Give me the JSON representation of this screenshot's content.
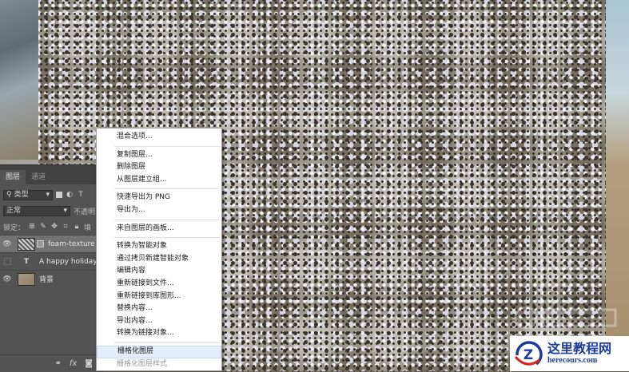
{
  "panel": {
    "tabs": [
      {
        "label": "图层",
        "active": true
      },
      {
        "label": "通道",
        "active": false
      }
    ],
    "filter": {
      "kind": "类型"
    },
    "blend_mode": "正常",
    "opacity_label": "不透明",
    "lock_label": "锁定：",
    "fill_label": "填",
    "layers": [
      {
        "name": "foam-texture",
        "visible": true,
        "selected": true,
        "type": "smart"
      },
      {
        "name": "A happy holiday",
        "visible": false,
        "selected": false,
        "type": "text"
      },
      {
        "name": "背景",
        "visible": true,
        "selected": false,
        "type": "image"
      }
    ]
  },
  "context_menu": {
    "groups": [
      [
        "混合选项..."
      ],
      [
        "复制图层...",
        "删除图层",
        "从图层建立组..."
      ],
      [
        "快速导出为 PNG",
        "导出为..."
      ],
      [
        "来自图层的画板..."
      ],
      [
        "转换为智能对象",
        "通过拷贝新建智能对象",
        "编辑内容",
        "重新链接到文件...",
        "重新链接到库图形...",
        "替换内容...",
        "导出内容...",
        "转换为链接对象..."
      ],
      [
        "栅格化图层",
        "栅格化图层样式"
      ]
    ],
    "highlighted": "栅格化图层",
    "disabled": [
      "栅格化图层样式"
    ]
  },
  "watermark": {
    "title": "这里教程网",
    "url": "herecours.com"
  },
  "icons": {
    "eye": "eye-icon",
    "search": "search-icon",
    "fx": "fx-icon",
    "mask": "mask-icon",
    "link": "link-icon"
  },
  "colors": {
    "panel_bg": "#535353",
    "menu_highlight": "#e6eefb",
    "watermark_blue": "#1b3d9a"
  }
}
